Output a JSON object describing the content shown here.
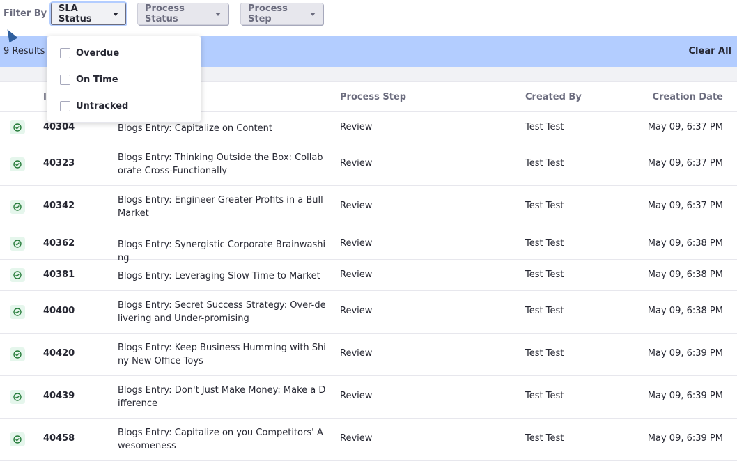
{
  "filter": {
    "label": "Filter By",
    "sla_status": "SLA Status",
    "process_status": "Process Status",
    "process_step": "Process Step"
  },
  "results": {
    "text": "9 Results f",
    "clear_all": "Clear All"
  },
  "dropdown": {
    "options": [
      "Overdue",
      "On Time",
      "Untracked"
    ]
  },
  "table": {
    "headers": {
      "id": "I",
      "process_step": "Process Step",
      "created_by": "Created By",
      "creation_date": "Creation Date"
    },
    "rows": [
      {
        "id": "40304",
        "title": "Blogs Entry: Capitalize on Content",
        "step": "Review",
        "by": "Test Test",
        "date": "May 09, 6:37 PM"
      },
      {
        "id": "40323",
        "title": "Blogs Entry: Thinking Outside the Box: Collaborate Cross-Functionally",
        "step": "Review",
        "by": "Test Test",
        "date": "May 09, 6:37 PM"
      },
      {
        "id": "40342",
        "title": "Blogs Entry: Engineer Greater Profits in a Bull Market",
        "step": "Review",
        "by": "Test Test",
        "date": "May 09, 6:37 PM"
      },
      {
        "id": "40362",
        "title": "Blogs Entry: Synergistic Corporate Brainwashing",
        "step": "Review",
        "by": "Test Test",
        "date": "May 09, 6:38 PM"
      },
      {
        "id": "40381",
        "title": "Blogs Entry: Leveraging Slow Time to Market",
        "step": "Review",
        "by": "Test Test",
        "date": "May 09, 6:38 PM"
      },
      {
        "id": "40400",
        "title": "Blogs Entry: Secret Success Strategy: Over-delivering and Under-promising",
        "step": "Review",
        "by": "Test Test",
        "date": "May 09, 6:38 PM"
      },
      {
        "id": "40420",
        "title": "Blogs Entry: Keep Business Humming with Shiny New Office Toys",
        "step": "Review",
        "by": "Test Test",
        "date": "May 09, 6:39 PM"
      },
      {
        "id": "40439",
        "title": "Blogs Entry: Don't Just Make Money: Make a Difference",
        "step": "Review",
        "by": "Test Test",
        "date": "May 09, 6:39 PM"
      },
      {
        "id": "40458",
        "title": "Blogs Entry: Capitalize on you Competitors' Awesomeness",
        "step": "Review",
        "by": "Test Test",
        "date": "May 09, 6:39 PM"
      }
    ]
  },
  "colors": {
    "results_bar": "#b3cdff",
    "status_ontime": "#287d3c"
  },
  "icons": {
    "row_status": "check-circle-icon"
  }
}
